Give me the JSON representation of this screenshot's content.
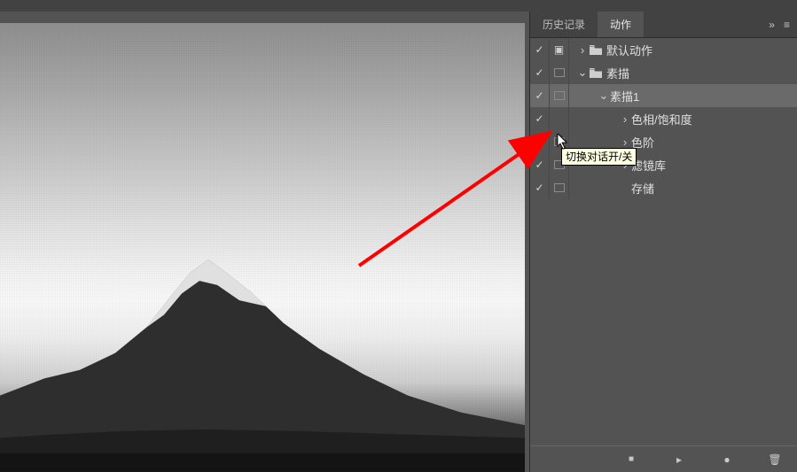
{
  "tabs": {
    "history": "历史记录",
    "actions": "动作",
    "more_glyph": "»",
    "menu_glyph": "≡"
  },
  "rows": [
    {
      "depth": 0,
      "check": true,
      "dialogBox": false,
      "showSetBtn": true,
      "disclosure": "right",
      "folder": true,
      "label": "默认动作",
      "selected": false
    },
    {
      "depth": 0,
      "check": true,
      "dialogBox": true,
      "showSetBtn": false,
      "disclosure": "down",
      "folder": true,
      "label": "素描",
      "selected": false
    },
    {
      "depth": 1,
      "check": true,
      "dialogBox": true,
      "showSetBtn": false,
      "disclosure": "down",
      "folder": false,
      "label": "素描1",
      "selected": true
    },
    {
      "depth": 2,
      "check": true,
      "dialogBox": false,
      "showSetBtn": false,
      "disclosure": "right",
      "folder": false,
      "label": "色相/饱和度",
      "selected": false
    },
    {
      "depth": 2,
      "check": true,
      "dialogBox": true,
      "showSetBtn": false,
      "disclosure": "right",
      "folder": false,
      "label": "色阶",
      "selected": false,
      "hasCursor": true
    },
    {
      "depth": 2,
      "check": true,
      "dialogBox": true,
      "showSetBtn": false,
      "disclosure": "right",
      "folder": false,
      "label": "滤镜库",
      "selected": false
    },
    {
      "depth": 2,
      "check": true,
      "dialogBox": true,
      "showSetBtn": false,
      "disclosure": "none",
      "folder": false,
      "label": "存储",
      "selected": false
    }
  ],
  "tooltip": "切换对话开/关",
  "footer": {
    "stop": "■",
    "play": "▸",
    "rec": "●",
    "trash": "🗑"
  },
  "glyphs": {
    "check": "✓",
    "chev_right": "›",
    "chev_down": "⌄",
    "folder": "▢",
    "set_btn": "▣"
  }
}
